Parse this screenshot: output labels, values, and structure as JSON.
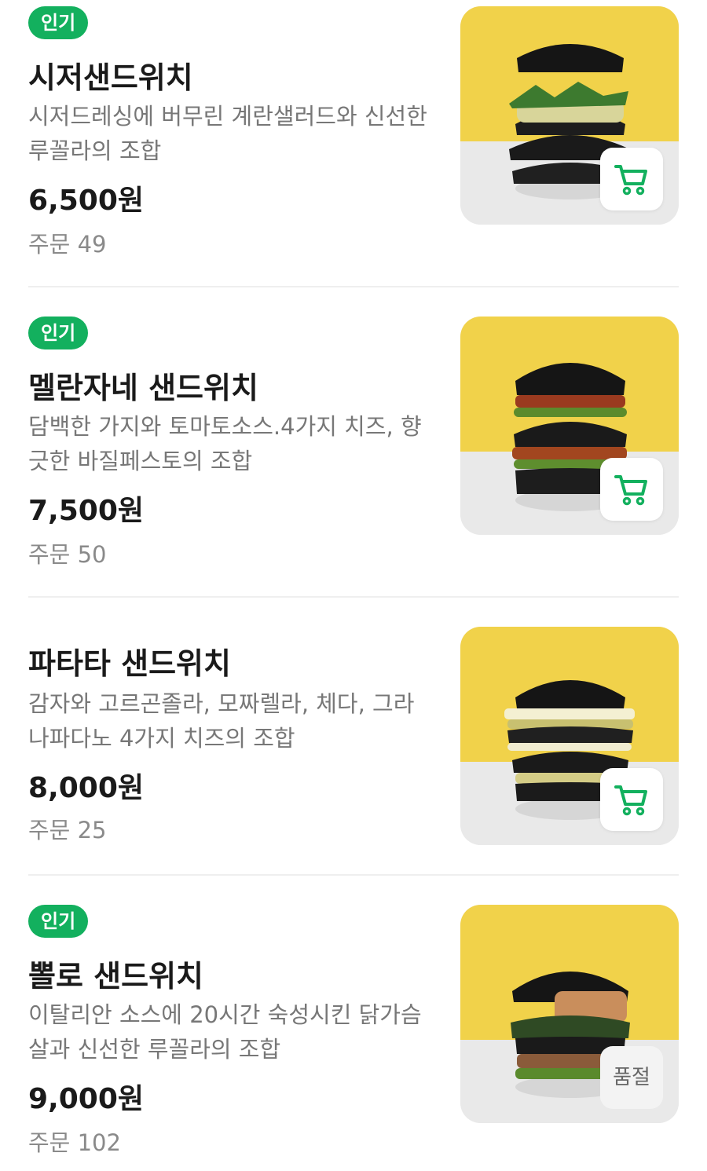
{
  "menu": {
    "items": [
      {
        "badge": "인기",
        "name": "시저샌드위치",
        "description": "시저드레싱에 버무린 계란샐러드와 신선한 루꼴라의 조합",
        "price": "6,500원",
        "orders": "주문 49",
        "action": "cart"
      },
      {
        "badge": "인기",
        "name": "멜란자네 샌드위치",
        "description": "담백한 가지와 토마토소스.4가지 치즈, 향긋한 바질페스토의 조합",
        "price": "7,500원",
        "orders": "주문 50",
        "action": "cart"
      },
      {
        "badge": "",
        "name": "파타타 샌드위치",
        "description": "감자와 고르곤졸라, 모짜렐라, 체다, 그라나파다노 4가지 치즈의 조합",
        "price": "8,000원",
        "orders": "주문 25",
        "action": "cart"
      },
      {
        "badge": "인기",
        "name": "뽈로 샌드위치",
        "description": "이탈리안 소스에 20시간 숙성시킨 닭가슴살과 신선한 루꼴라의 조합",
        "price": "9,000원",
        "orders": "주문 102",
        "action": "sold_out",
        "sold_out_label": "품절"
      }
    ]
  },
  "icons": {
    "cart": "cart-icon"
  },
  "colors": {
    "badge_bg": "#13b05e",
    "cart_icon": "#13b05e",
    "thumb_top": "#f1d24a",
    "thumb_bottom": "#e9e9e9"
  }
}
